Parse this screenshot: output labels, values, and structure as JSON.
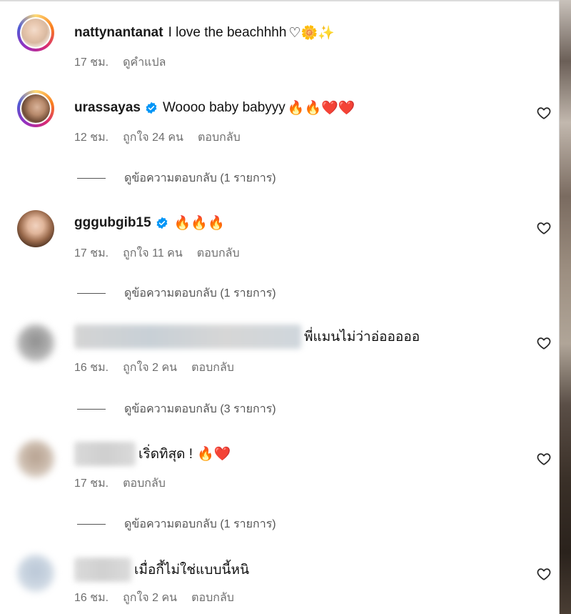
{
  "comments": [
    {
      "username": "nattynantanat",
      "text": "I love the beachhhh",
      "emoji": "♡🌼✨",
      "time": "17 ชม.",
      "action": "ดูคำแปล"
    },
    {
      "username": "urassayas",
      "text": "Woooo baby babyyy",
      "emoji": "🔥🔥❤️❤️",
      "time": "12 ชม.",
      "likes": "ถูกใจ 24 คน",
      "reply": "ตอบกลับ",
      "view_replies": "ดูข้อความตอบกลับ (1 รายการ)"
    },
    {
      "username": "gggubgib15",
      "emoji": "🔥🔥🔥",
      "time": "17 ชม.",
      "likes": "ถูกใจ 11 คน",
      "reply": "ตอบกลับ",
      "view_replies": "ดูข้อความตอบกลับ (1 รายการ)"
    },
    {
      "text": "พี่แมนไม่ว่าอ่อออออ",
      "time": "16 ชม.",
      "likes": "ถูกใจ 2 คน",
      "reply": "ตอบกลับ",
      "view_replies": "ดูข้อความตอบกลับ (3 รายการ)"
    },
    {
      "text": "เริ่ดทิสุด !",
      "emoji": "🔥❤️",
      "time": "17 ชม.",
      "reply": "ตอบกลับ",
      "view_replies": "ดูข้อความตอบกลับ (1 รายการ)"
    },
    {
      "text": "เมื่อกี้ไม่ใช่แบบนี้หนิ",
      "time": "16 ชม.",
      "likes": "ถูกใจ 2 คน",
      "reply": "ตอบกลับ"
    }
  ],
  "colors": {
    "meta_text": "#6e6e6e",
    "verified_badge": "#0095f6",
    "story_ring": [
      "#feda75",
      "#fa7e1e",
      "#d62976",
      "#962fbf",
      "#4f5bd5"
    ]
  },
  "icons": {
    "like": "heart-outline-icon",
    "verified": "verified-badge-icon"
  }
}
